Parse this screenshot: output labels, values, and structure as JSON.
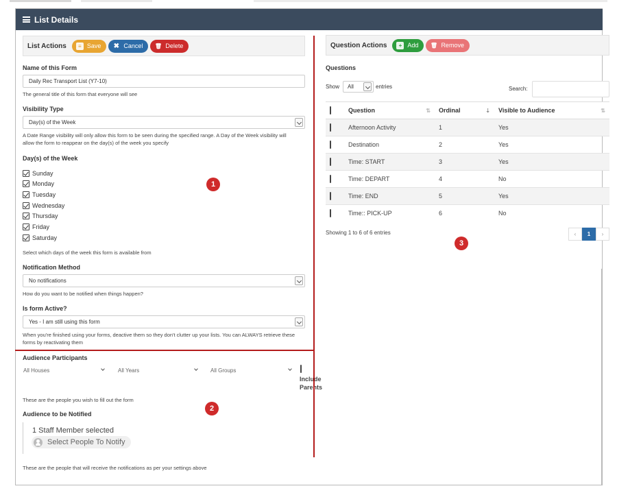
{
  "header": {
    "title": "List Details"
  },
  "list_actions": {
    "title": "List Actions",
    "save_label": "Save",
    "cancel_label": "Cancel",
    "delete_label": "Delete"
  },
  "form": {
    "name_label": "Name of this Form",
    "name_value": "Daily Rec Transport List (Y7-10)",
    "name_help": "The general title of this form that everyone will see",
    "visibility_label": "Visibility Type",
    "visibility_value": "Day(s) of the Week",
    "visibility_help_1": "A Date Range visibility will only allow this form to be seen during the specified range. A Day of the Week visibility will",
    "visibility_help_2": "allow the form to reappear on the day(s) of the week you specify",
    "days_label": "Day(s) of the Week",
    "days": [
      "Sunday",
      "Monday",
      "Tuesday",
      "Wednesday",
      "Thursday",
      "Friday",
      "Saturday"
    ],
    "days_help": "Select which days of the week this form is available from",
    "notification_label": "Notification Method",
    "notification_value": "No notifications",
    "notification_help": "How do you want to be notified when things happen?",
    "active_label": "Is form Active?",
    "active_value": "Yes - I am still using this form",
    "active_help_1": "When you're finished using your forms, deactive them so they don't clutter up your lists. You can ALWAYS retrieve these",
    "active_help_2": "forms by reactivating them"
  },
  "audience": {
    "participants_label": "Audience Participants",
    "houses": "All Houses",
    "years": "All Years",
    "groups": "All Groups",
    "include_label_1": "Include",
    "include_label_2": "Parents",
    "participants_help": "These are the people you wish to fill out the form",
    "notified_label": "Audience to be Notified",
    "notified_count": "1 Staff Member selected",
    "notified_select": "Select People To Notify",
    "notified_help": "These are the people that will receive the notifications as per your settings above"
  },
  "question_actions": {
    "title": "Question Actions",
    "add_label": "Add",
    "remove_label": "Remove"
  },
  "questions": {
    "label": "Questions",
    "show_label": "Show",
    "show_value": "All",
    "entries_label": "entries",
    "search_label": "Search:",
    "columns": [
      "Question",
      "Ordinal",
      "Visible to Audience"
    ],
    "rows": [
      {
        "question": "Afternoon Activity",
        "ordinal": "1",
        "visible": "Yes"
      },
      {
        "question": "Destination",
        "ordinal": "2",
        "visible": "Yes"
      },
      {
        "question": "Time: START",
        "ordinal": "3",
        "visible": "Yes"
      },
      {
        "question": "Time: DEPART",
        "ordinal": "4",
        "visible": "No"
      },
      {
        "question": "Time: END",
        "ordinal": "5",
        "visible": "Yes"
      },
      {
        "question": "Time:: PICK-UP",
        "ordinal": "6",
        "visible": "No"
      }
    ],
    "showing": "Showing 1 to 6 of 6 entries",
    "prev": "‹",
    "page": "1",
    "next": "›"
  },
  "markers": [
    "1",
    "2",
    "3"
  ],
  "colors": {
    "header_bg": "#3b4b5e",
    "annotation_red": "#b31b1b",
    "primary": "#2d6ca8"
  }
}
